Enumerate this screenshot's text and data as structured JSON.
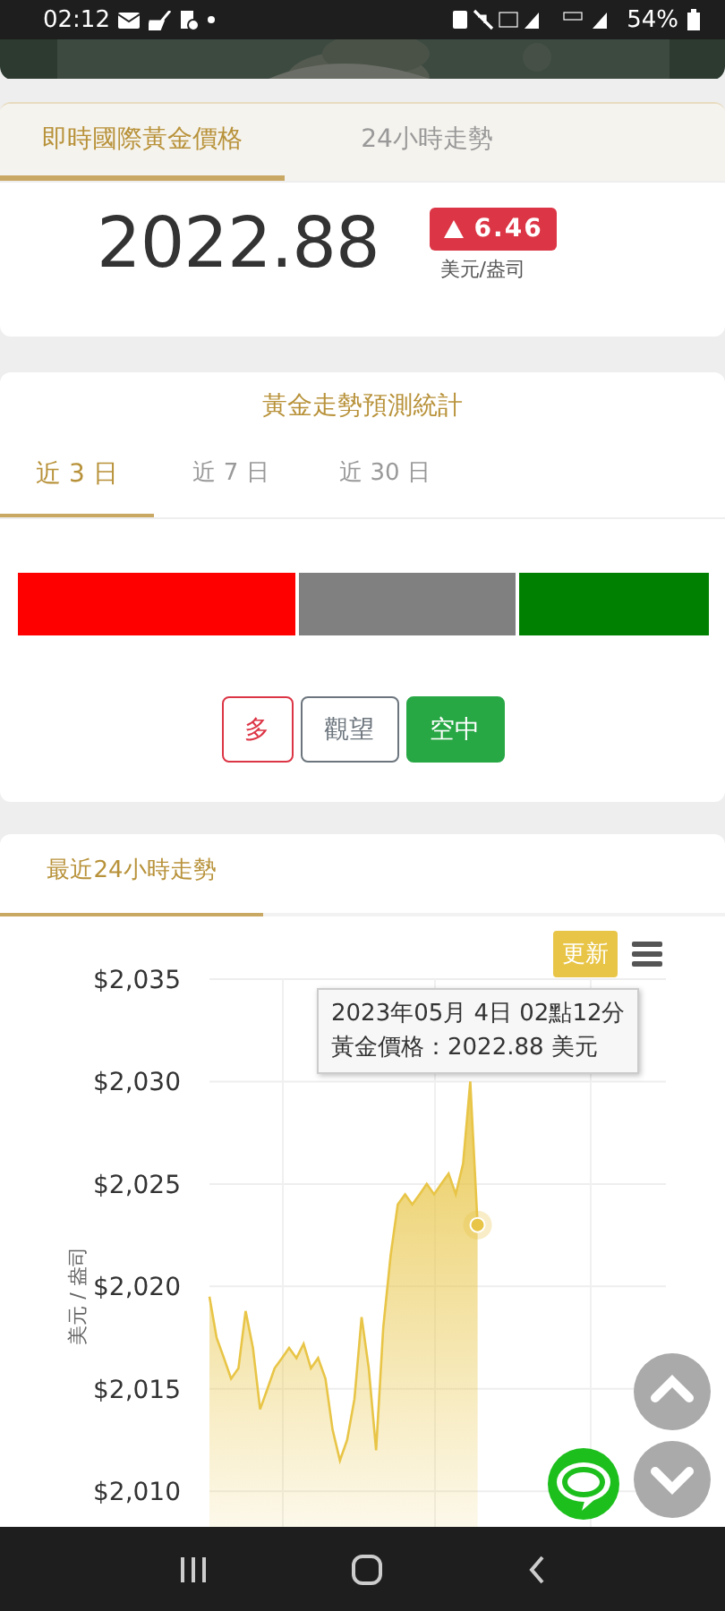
{
  "status_bar": {
    "time": "02:12",
    "battery": "54%"
  },
  "price_card": {
    "tabs": [
      {
        "label": "即時國際黃金價格",
        "selected": true
      },
      {
        "label": "24小時走勢",
        "selected": false
      }
    ],
    "price": "2022.88",
    "change": "6.46",
    "unit": "美元/盎司"
  },
  "forecast": {
    "title": "黃金走勢預測統計",
    "tabs": [
      {
        "label": "近 3 日",
        "selected": true
      },
      {
        "label": "近 7 日",
        "selected": false
      },
      {
        "label": "近 30 日",
        "selected": false
      }
    ],
    "segments": [
      {
        "color": "#ff0000"
      },
      {
        "color": "#808080"
      },
      {
        "color": "#008000"
      }
    ],
    "buttons": [
      {
        "label": "多",
        "kind": "outline-red"
      },
      {
        "label": "觀望",
        "kind": "outline-gray"
      },
      {
        "label": "空中",
        "kind": "solid-green"
      }
    ]
  },
  "trend": {
    "tab": {
      "label": "最近24小時走勢",
      "selected": true
    },
    "refresh_button": "更新",
    "tooltip": {
      "line1": "2023年05月 4日 02點12分",
      "line2": "黃金價格：2022.88 美元"
    },
    "chart_data": {
      "type": "area",
      "ylabel": "美元 / 盎司",
      "grid": true,
      "ylim": [
        2008,
        2035
      ],
      "yticks": [
        {
          "value": 2010,
          "label": "$2,010"
        },
        {
          "value": 2015,
          "label": "$2,015"
        },
        {
          "value": 2020,
          "label": "$2,020"
        },
        {
          "value": 2025,
          "label": "$2,025"
        },
        {
          "value": 2030,
          "label": "$2,030"
        },
        {
          "value": 2035,
          "label": "$2,035"
        }
      ],
      "series": [
        {
          "color": "#e8c547",
          "values": [
            2019.5,
            2017.5,
            2016.5,
            2015.5,
            2016,
            2018.8,
            2017,
            2014,
            2015,
            2016,
            2016.5,
            2017,
            2016.5,
            2017.2,
            2016,
            2016.5,
            2015.5,
            2013,
            2011.5,
            2012.5,
            2014.5,
            2018.5,
            2016,
            2012,
            2018,
            2021.5,
            2024,
            2024.5,
            2024,
            2024.5,
            2025,
            2024.5,
            2025,
            2025.5,
            2024.5,
            2026,
            2030,
            2023
          ]
        }
      ]
    }
  }
}
